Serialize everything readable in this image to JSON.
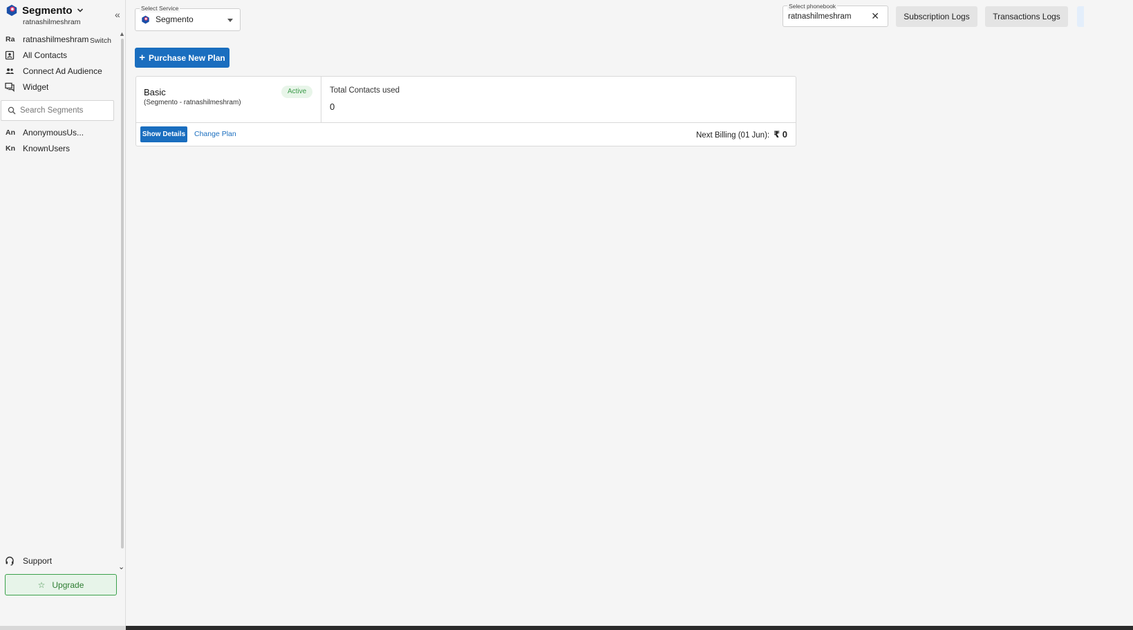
{
  "app": {
    "name": "Segmento",
    "account": "ratnashilmeshram"
  },
  "sidebar": {
    "collapse_icon": "double-chevron-left-icon",
    "phonebook_row": {
      "abbr": "Ra",
      "label": "ratnashilmeshram",
      "switch": "Switch"
    },
    "nav": [
      {
        "label": "All Contacts",
        "icon": "contacts-icon"
      },
      {
        "label": "Connect Ad Audience",
        "icon": "people-icon"
      },
      {
        "label": "Widget",
        "icon": "chat-icon"
      }
    ],
    "search_placeholder": "Search Segments",
    "segments": [
      {
        "abbr": "An",
        "label": "AnonymousUs..."
      },
      {
        "abbr": "Kn",
        "label": "KnownUsers"
      }
    ],
    "support": "Support",
    "upgrade": "Upgrade"
  },
  "header": {
    "service_label": "Select Service",
    "service_value": "Segmento",
    "phonebook_label": "Select phonebook",
    "phonebook_value": "ratnashilmeshram",
    "subscription_logs": "Subscription Logs",
    "transactions_logs": "Transactions Logs"
  },
  "main": {
    "purchase_button": "Purchase New Plan",
    "plan": {
      "name": "Basic",
      "subtitle": "(Segmento - ratnashilmeshram)",
      "status": "Active",
      "contacts_label": "Total Contacts used",
      "contacts_value": "0",
      "show_details": "Show Details",
      "change_plan": "Change Plan",
      "next_billing": "Next Billing (01 Jun):",
      "amount": "₹ 0"
    }
  },
  "colors": {
    "primary": "#1a6ebf",
    "success": "#3a9a48",
    "logo_blue": "#1a4fa8",
    "logo_pink": "#e23a6a"
  }
}
